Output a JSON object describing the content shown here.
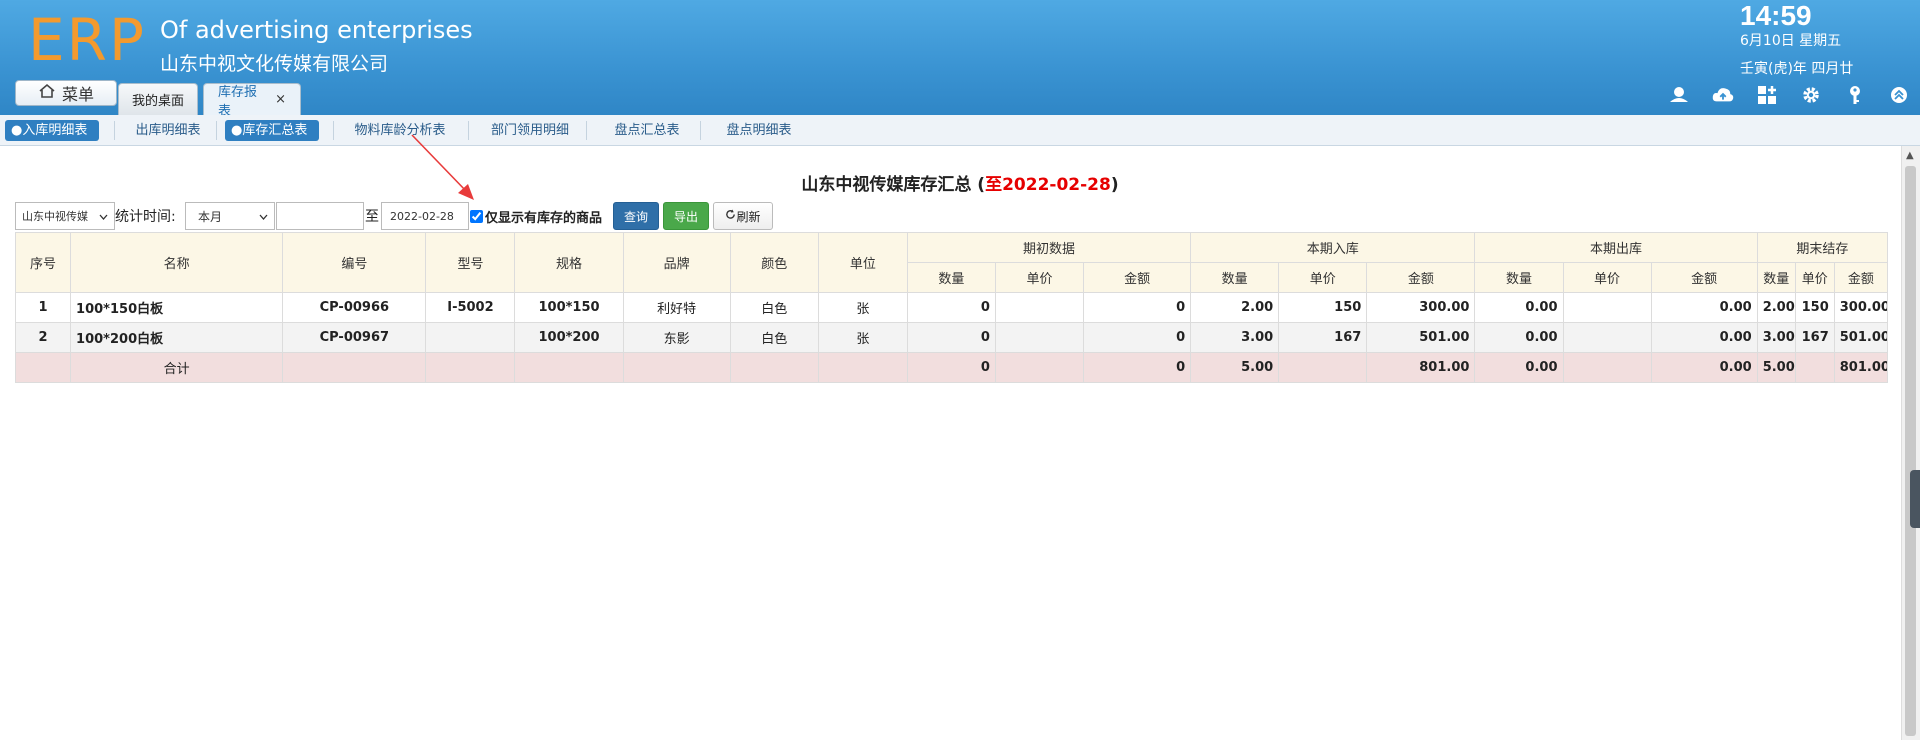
{
  "header": {
    "logo": "ERP",
    "company_en": "Of advertising enterprises",
    "company_cn": "山东中视文化传媒有限公司",
    "time": "14:59",
    "date_line1": "6月10日 星期五",
    "date_line2": "壬寅(虎)年 四月廿",
    "menu_label": "菜单",
    "tabs": [
      {
        "label": "我的桌面"
      },
      {
        "label": "库存报表",
        "close": "×"
      }
    ],
    "tool_icons": [
      "user-icon",
      "cloud-upload-icon",
      "grid-add-icon",
      "gear-icon",
      "key-icon",
      "chevron-up-circle-icon"
    ]
  },
  "subnav": {
    "items": [
      {
        "label": "●入库明细表",
        "active": true
      },
      {
        "label": "出库明细表",
        "active": false
      },
      {
        "label": "●库存汇总表",
        "active": true
      },
      {
        "label": "物料库龄分析表",
        "active": false
      },
      {
        "label": "部门领用明细",
        "active": false
      },
      {
        "label": "盘点汇总表",
        "active": false
      },
      {
        "label": "盘点明细表",
        "active": false
      }
    ]
  },
  "report": {
    "title_prefix": "山东中视传媒库存汇总 (",
    "title_date": "至2022-02-28",
    "title_suffix": ")"
  },
  "filters": {
    "company_select": "山东中视传媒",
    "time_label": "统计时间:",
    "period_select": "本月",
    "start_date": "",
    "to_label": "至",
    "end_date": "2022-02-28",
    "only_stock_label": "仅显示有库存的商品",
    "query_btn": "查询",
    "export_btn": "导出",
    "refresh_btn": "刷新"
  },
  "table": {
    "headers_top": [
      "序号",
      "名称",
      "编号",
      "型号",
      "规格",
      "品牌",
      "颜色",
      "单位",
      "期初数据",
      "本期入库",
      "本期出库",
      "期末结存"
    ],
    "headers_sub": [
      "数量",
      "单价",
      "金额",
      "数量",
      "单价",
      "金额",
      "数量",
      "单价",
      "金额",
      "数量",
      "单价",
      "金额"
    ],
    "rows": [
      [
        "1",
        "100*150白板",
        "CP-00966",
        "I-5002",
        "100*150",
        "利好特",
        "白色",
        "张",
        "0",
        "",
        "0",
        "2.00",
        "150",
        "300.00",
        "0.00",
        "",
        "0.00",
        "2.00",
        "150",
        "300.00"
      ],
      [
        "2",
        "100*200白板",
        "CP-00967",
        "",
        "100*200",
        "东影",
        "白色",
        "张",
        "0",
        "",
        "0",
        "3.00",
        "167",
        "501.00",
        "0.00",
        "",
        "0.00",
        "3.00",
        "167",
        "501.00"
      ]
    ],
    "total": {
      "label": "合计",
      "values": [
        "0",
        "",
        "0",
        "5.00",
        "",
        "801.00",
        "0.00",
        "",
        "0.00",
        "5.00",
        "",
        "801.00"
      ]
    }
  }
}
